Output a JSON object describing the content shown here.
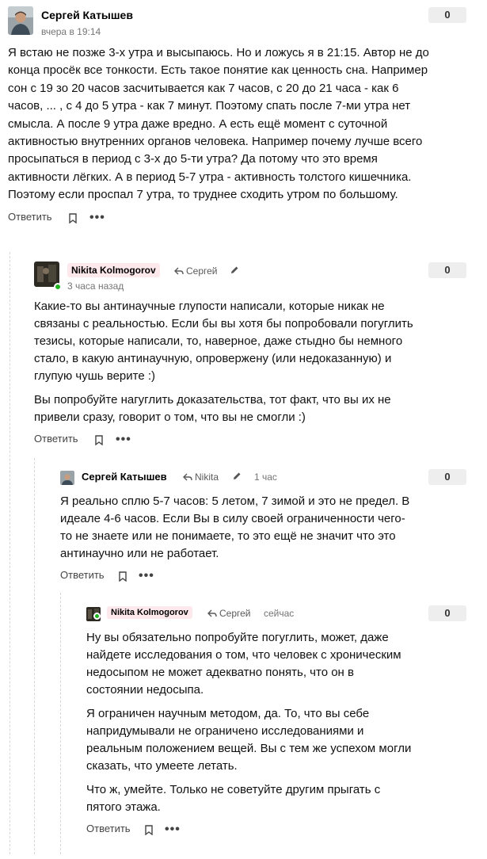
{
  "comments": [
    {
      "author": "Сергей Катышев",
      "time": "вчера в 19:14",
      "score": "0",
      "paragraphs": [
        "Я встаю не позже 3-х утра и высыпаюсь. Но и ложусь я в 21:15. Автор не до конца просёк все тонкости. Есть такое понятие как ценность сна. Например сон с 19 зо 20 часов засчитывается как 7 часов, с 20 до 21 часа - как 6 часов, ... , с 4 до 5 утра - как 7 минут. Поэтому спать после 7-ми утра нет смысла. А после 9 утра даже вредно. А есть ещё момент с суточной активностью внутренних органов человека. Например почему лучше всего просыпаться в период с 3-х до 5-ти утра? Да потому что это время активности лёгких. А в период 5-7 утра - активность толстого кишечника. Поэтому если проспал 7 утра, то труднее сходить утром по большому."
      ],
      "reply_label": "Ответить"
    },
    {
      "author": "Nikita Kolmogorov",
      "reply_to": "Сергей",
      "time": "3 часа назад",
      "score": "0",
      "paragraphs": [
        "Какие-то вы антинаучные глупости написали, которые никак не связаны с реальностью. Если бы вы хотя бы попробовали погуглить тезисы, которые написали, то, наверное, даже стыдно бы немного стало, в какую антинаучную, опровержену (или недоказанную) и глупую чушь верите :)",
        "Вы попробуйте нагуглить доказательства, тот факт, что вы их не привели сразу, говорит о том, что вы не смогли :)"
      ],
      "reply_label": "Ответить"
    },
    {
      "author": "Сергей Катышев",
      "reply_to": "Nikita",
      "time": "1 час",
      "score": "0",
      "paragraphs": [
        "Я реально сплю 5-7 часов: 5 летом, 7 зимой и это не предел. В идеале 4-6 часов. Если Вы в силу своей ограниченности чего-то не знаете или не понимаете, то это ещё не значит что это антинаучно или не работает."
      ],
      "reply_label": "Ответить"
    },
    {
      "author": "Nikita Kolmogorov",
      "reply_to": "Сергей",
      "time": "сейчас",
      "score": "0",
      "paragraphs": [
        "Ну вы обязательно попробуйте погуглить, может, даже найдете исследования о том, что человек с хроническим недосыпом не может адекватно понять, что он в состоянии недосыпа.",
        "Я ограничен научным методом, да. То, что вы себе напридумывали не ограничено исследованиями и реальным положением вещей. Вы с тем же успехом могли сказать, что умеете летать.",
        "Что ж, умейте. Только не советуйте другим прыгать с пятого этажа."
      ],
      "reply_label": "Ответить"
    }
  ]
}
